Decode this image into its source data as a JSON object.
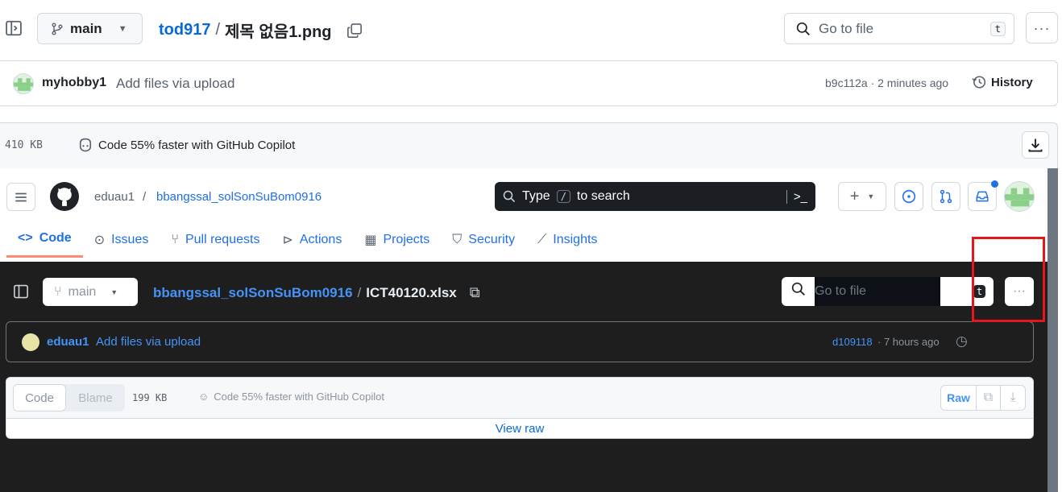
{
  "topbar": {
    "branch": "main",
    "repo_owner": "tod917",
    "separator": "/",
    "file_name": "제목 없음1.png",
    "goto_placeholder": "Go to file",
    "goto_shortcut": "t"
  },
  "commit": {
    "author": "myhobby1",
    "message": "Add files via upload",
    "meta": "b9c112a · 2 minutes ago",
    "history_label": "History"
  },
  "file_info": {
    "size": "410 KB",
    "copilot": "Code 55% faster with GitHub Copilot"
  },
  "embedded": {
    "owner": "eduau1",
    "slash": "/",
    "repo": "bbangssal_solSonSuBom0916",
    "search_prefix": "Type",
    "search_key": "/",
    "search_suffix": "to search",
    "tabs": [
      "Code",
      "Issues",
      "Pull requests",
      "Actions",
      "Projects",
      "Security",
      "Insights"
    ],
    "branch": "main",
    "crumb_repo": "bbangssal_solSonSuBom0916",
    "crumb_sep": "/",
    "crumb_file": "ICT40120.xlsx",
    "goto_placeholder": "Go to file",
    "goto_shortcut": "t",
    "commit_author": "eduau1",
    "commit_message": "Add files via upload",
    "commit_hash": "d109118",
    "commit_time": "· 7 hours ago",
    "toggle_code": "Code",
    "toggle_blame": "Blame",
    "size": "199 KB",
    "copilot": "Code 55% faster with GitHub Copilot",
    "raw_label": "Raw",
    "view_raw": "View raw"
  },
  "colors": {
    "link": "#0969da",
    "highlight": "#e5171d",
    "tab_underline": "#fd8c73"
  }
}
